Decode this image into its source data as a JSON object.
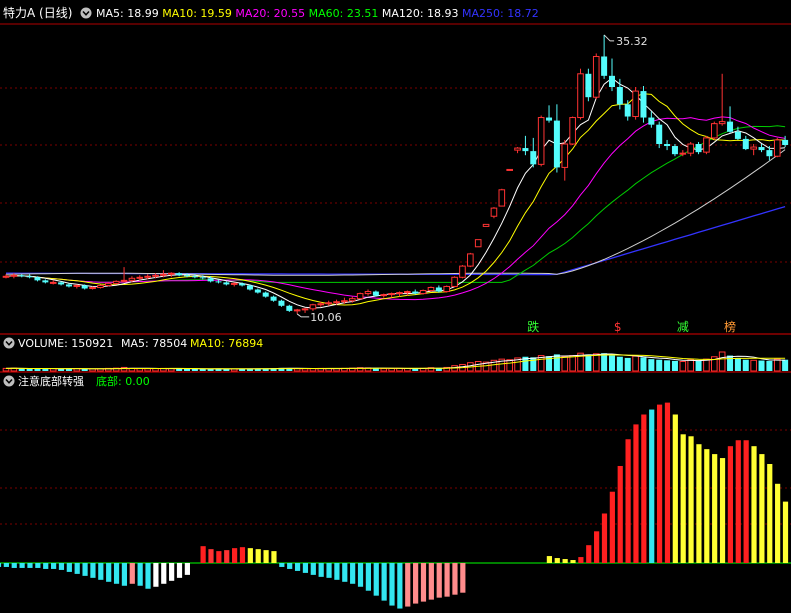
{
  "main_panel": {
    "title": "特力A (日线)",
    "indicators": [
      {
        "label": "MA5: 18.99",
        "color": "#ffffff"
      },
      {
        "label": "MA10: 19.59",
        "color": "#ffff00"
      },
      {
        "label": "MA20: 20.55",
        "color": "#ff00ff"
      },
      {
        "label": "MA60: 23.51",
        "color": "#00ff00"
      },
      {
        "label": "MA120: 18.93",
        "color": "#ffffff"
      },
      {
        "label": "MA250: 18.72",
        "color": "#3333ff"
      }
    ],
    "high_label": "35.32",
    "low_label": "10.06",
    "markers": [
      {
        "text": "跌",
        "color": "#33ff33"
      },
      {
        "text": "$",
        "color": "#ff3333"
      },
      {
        "text": "减",
        "color": "#33ff33"
      },
      {
        "text": "榜",
        "color": "#ff9933"
      }
    ]
  },
  "volume_panel": {
    "label": "VOLUME: 150921",
    "ma5": "MA5: 78504",
    "ma10": "MA10: 76894"
  },
  "indicator_panel": {
    "name": "注意底部转强",
    "value_label": "底部: 0.00"
  },
  "colors": {
    "up": "#ff3333",
    "down": "#54fcfc",
    "grid": "#7a0000",
    "baseline": "#00ff00"
  },
  "candles": [
    [
      11.6,
      11.8,
      11.4,
      11.6
    ],
    [
      11.6,
      11.9,
      11.4,
      11.7
    ],
    [
      11.7,
      11.8,
      11.5,
      11.6
    ],
    [
      11.6,
      11.8,
      11.4,
      11.5
    ],
    [
      11.5,
      11.6,
      11.1,
      11.2
    ],
    [
      11.2,
      11.3,
      10.9,
      11.0
    ],
    [
      11.0,
      11.2,
      10.8,
      11.0
    ],
    [
      11.0,
      11.1,
      10.7,
      10.8
    ],
    [
      10.8,
      10.9,
      10.5,
      10.6
    ],
    [
      10.6,
      10.8,
      10.4,
      10.7
    ],
    [
      10.7,
      10.8,
      10.3,
      10.4
    ],
    [
      10.4,
      10.6,
      10.3,
      10.5
    ],
    [
      10.5,
      10.8,
      10.4,
      10.7
    ],
    [
      10.7,
      11.0,
      10.6,
      10.9
    ],
    [
      10.9,
      11.2,
      10.8,
      11.1
    ],
    [
      11.1,
      12.5,
      11.0,
      11.2
    ],
    [
      11.2,
      11.6,
      11.0,
      11.4
    ],
    [
      11.4,
      11.7,
      11.2,
      11.5
    ],
    [
      11.5,
      11.8,
      11.3,
      11.6
    ],
    [
      11.6,
      11.9,
      11.4,
      11.7
    ],
    [
      11.7,
      12.2,
      11.5,
      11.8
    ],
    [
      11.8,
      12.0,
      11.5,
      11.9
    ],
    [
      11.9,
      12.0,
      11.6,
      11.7
    ],
    [
      11.7,
      11.9,
      11.5,
      11.6
    ],
    [
      11.6,
      11.8,
      11.4,
      11.5
    ],
    [
      11.5,
      11.7,
      11.3,
      11.4
    ],
    [
      11.4,
      11.6,
      11.0,
      11.1
    ],
    [
      11.1,
      11.3,
      10.9,
      11.0
    ],
    [
      11.0,
      11.1,
      10.7,
      10.8
    ],
    [
      10.8,
      11.0,
      10.6,
      10.9
    ],
    [
      10.9,
      11.0,
      10.6,
      10.7
    ],
    [
      10.7,
      10.8,
      10.2,
      10.3
    ],
    [
      10.3,
      10.4,
      9.9,
      10.0
    ],
    [
      10.0,
      10.1,
      9.5,
      9.6
    ],
    [
      9.6,
      9.7,
      9.1,
      9.2
    ],
    [
      9.2,
      9.3,
      8.6,
      8.7
    ],
    [
      8.7,
      8.8,
      8.1,
      8.2
    ],
    [
      8.2,
      8.4,
      7.9,
      8.3
    ],
    [
      8.3,
      8.5,
      8.0,
      8.4
    ],
    [
      8.4,
      8.9,
      8.2,
      8.8
    ],
    [
      8.8,
      9.1,
      8.6,
      8.9
    ],
    [
      8.9,
      9.2,
      8.7,
      9.0
    ],
    [
      9.0,
      9.3,
      8.8,
      9.1
    ],
    [
      9.1,
      9.5,
      8.9,
      9.2
    ],
    [
      9.2,
      9.6,
      9.0,
      9.4
    ],
    [
      9.4,
      10.0,
      9.3,
      9.9
    ],
    [
      9.9,
      10.3,
      9.7,
      10.1
    ],
    [
      10.1,
      10.2,
      9.6,
      9.7
    ],
    [
      9.7,
      9.9,
      9.5,
      9.8
    ],
    [
      9.8,
      10.0,
      9.5,
      9.9
    ],
    [
      9.9,
      10.1,
      9.6,
      10.0
    ],
    [
      10.0,
      10.2,
      9.7,
      10.1
    ],
    [
      10.1,
      10.3,
      9.8,
      9.9
    ],
    [
      9.9,
      10.3,
      9.8,
      10.2
    ],
    [
      10.2,
      10.6,
      10.1,
      10.5
    ],
    [
      10.5,
      10.7,
      10.0,
      10.1
    ],
    [
      10.1,
      10.7,
      10.0,
      10.6
    ],
    [
      10.6,
      11.6,
      10.5,
      11.5
    ],
    [
      11.5,
      12.7,
      11.4,
      12.6
    ],
    [
      12.6,
      13.9,
      12.5,
      13.8
    ],
    [
      14.5,
      15.2,
      14.5,
      15.2
    ],
    [
      16.5,
      16.7,
      16.5,
      16.7
    ],
    [
      17.5,
      18.4,
      17.3,
      18.3
    ],
    [
      18.5,
      20.2,
      18.5,
      20.1
    ],
    [
      22.0,
      22.1,
      22.0,
      22.1
    ],
    [
      24.0,
      24.3,
      23.7,
      24.2
    ],
    [
      24.2,
      25.4,
      23.5,
      23.9
    ],
    [
      23.9,
      25.2,
      22.3,
      22.6
    ],
    [
      22.6,
      27.4,
      22.4,
      27.2
    ],
    [
      27.2,
      28.4,
      26.7,
      26.9
    ],
    [
      26.9,
      28.5,
      21.8,
      22.3
    ],
    [
      22.3,
      25.0,
      21.0,
      24.6
    ],
    [
      24.6,
      27.3,
      24.5,
      27.2
    ],
    [
      27.2,
      32.0,
      27.0,
      31.5
    ],
    [
      31.5,
      32.0,
      28.8,
      29.2
    ],
    [
      29.2,
      33.5,
      29.0,
      33.2
    ],
    [
      33.2,
      35.32,
      31.0,
      31.3
    ],
    [
      31.3,
      33.0,
      29.8,
      30.2
    ],
    [
      30.2,
      31.0,
      28.0,
      28.5
    ],
    [
      28.5,
      28.9,
      26.9,
      27.3
    ],
    [
      27.3,
      30.2,
      27.0,
      29.8
    ],
    [
      29.8,
      30.3,
      26.7,
      27.2
    ],
    [
      27.2,
      27.8,
      26.2,
      26.5
    ],
    [
      26.5,
      26.8,
      24.2,
      24.6
    ],
    [
      24.6,
      25.0,
      24.0,
      24.4
    ],
    [
      24.4,
      24.6,
      23.4,
      23.6
    ],
    [
      23.6,
      24.0,
      23.4,
      23.7
    ],
    [
      23.7,
      24.8,
      23.4,
      24.6
    ],
    [
      24.6,
      24.8,
      23.6,
      23.8
    ],
    [
      23.8,
      25.4,
      23.6,
      25.2
    ],
    [
      25.2,
      26.8,
      25.0,
      26.6
    ],
    [
      26.6,
      31.5,
      26.4,
      26.8
    ],
    [
      26.8,
      28.3,
      25.7,
      25.8
    ],
    [
      25.8,
      26.3,
      25.0,
      25.1
    ],
    [
      25.1,
      25.4,
      24.0,
      24.1
    ],
    [
      24.1,
      24.6,
      23.5,
      24.3
    ],
    [
      24.3,
      24.6,
      23.8,
      24.0
    ],
    [
      24.0,
      24.4,
      23.0,
      23.4
    ],
    [
      23.4,
      25.2,
      23.3,
      25.0
    ],
    [
      25.0,
      25.4,
      24.3,
      24.5
    ]
  ],
  "volume": [
    22,
    24,
    20,
    18,
    20,
    22,
    20,
    18,
    19,
    20,
    18,
    17,
    18,
    22,
    24,
    30,
    22,
    20,
    19,
    20,
    22,
    20,
    18,
    19,
    18,
    17,
    18,
    19,
    18,
    17,
    18,
    19,
    20,
    22,
    24,
    26,
    22,
    20,
    19,
    20,
    22,
    21,
    20,
    22,
    24,
    28,
    26,
    22,
    20,
    21,
    22,
    21,
    20,
    22,
    28,
    24,
    30,
    45,
    55,
    70,
    80,
    75,
    90,
    100,
    95,
    110,
    120,
    115,
    130,
    125,
    140,
    120,
    130,
    150,
    140,
    145,
    150,
    130,
    120,
    110,
    125,
    115,
    100,
    95,
    90,
    85,
    80,
    95,
    90,
    100,
    120,
    160,
    130,
    110,
    95,
    90,
    88,
    85,
    100,
    95
  ],
  "osc": [
    -5,
    -5,
    -6,
    -6,
    -7,
    -4,
    -3,
    -2,
    -8,
    -10,
    -11,
    -13,
    -16,
    -18,
    -19,
    -21,
    -24,
    -26,
    -24,
    -20,
    -2,
    17,
    13,
    11,
    12,
    14,
    16,
    15,
    14,
    13,
    12,
    -3,
    -5,
    -7,
    -10,
    -12,
    -14,
    -15,
    -16,
    -18,
    -20,
    -25,
    -28,
    -33,
    -38,
    -43,
    -46,
    -42,
    -40,
    -38,
    -36,
    -35,
    -34,
    -32,
    0,
    -2,
    0,
    0,
    0,
    0,
    8,
    6,
    4,
    3,
    6,
    18,
    30,
    45,
    70,
    95,
    120,
    138,
    148,
    155,
    160,
    162,
    150,
    130,
    125,
    118,
    112,
    108,
    105,
    118,
    122,
    122,
    118,
    110,
    100,
    80,
    62,
    45,
    28,
    10,
    -5,
    -15,
    -18,
    -22,
    -15,
    -10
  ],
  "osc_pre": [
    -4,
    -4,
    -5,
    -5,
    -5,
    -5,
    -6,
    -6,
    -7,
    -9,
    -11,
    -13,
    -15,
    -17,
    -19,
    -21,
    -23,
    -21,
    -23,
    -26,
    -24,
    -21,
    -18,
    -15,
    -12,
    0,
    17,
    14,
    12,
    13,
    15,
    16,
    15,
    14,
    13,
    12,
    -4,
    -6,
    -8,
    -10,
    -12,
    -14,
    -15,
    -17,
    -19,
    -21,
    -24,
    -28,
    -33,
    -38,
    -43,
    -46,
    -44,
    -41,
    -39,
    -37,
    -35,
    -34,
    -32,
    -30,
    0,
    0,
    0,
    0,
    0,
    0,
    0,
    0,
    0,
    0,
    7,
    5,
    4,
    3,
    6,
    18,
    32,
    50,
    72,
    98,
    125,
    140,
    150,
    155,
    160,
    162,
    150,
    130,
    128,
    120,
    115,
    110,
    106,
    118,
    124,
    124,
    118,
    110,
    100,
    80,
    62,
    45,
    28,
    10,
    -6,
    -15,
    -18,
    -22,
    -15,
    -10
  ]
}
